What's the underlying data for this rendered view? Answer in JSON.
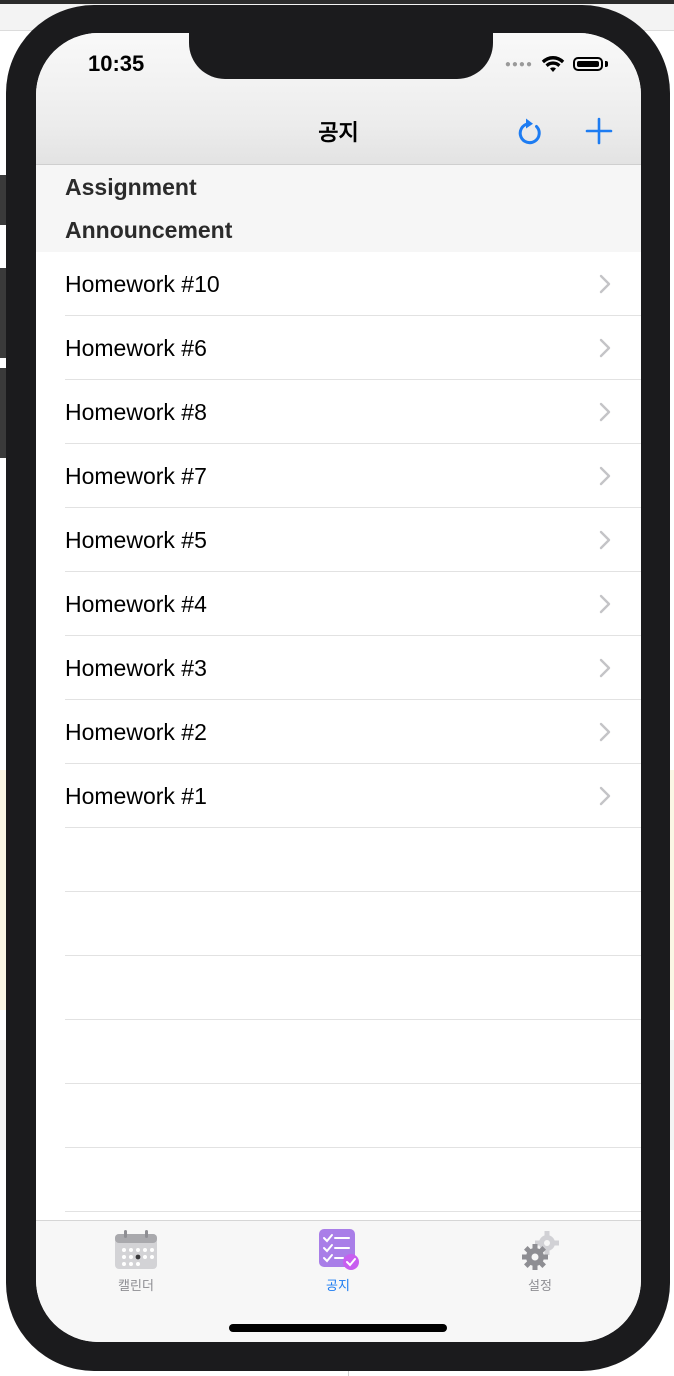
{
  "status_bar": {
    "time": "10:35"
  },
  "nav_bar": {
    "title": "공지",
    "actions": [
      "refresh-icon",
      "add-icon"
    ],
    "accent_color": "#1d7cf2"
  },
  "sections": [
    {
      "title": "Assignment"
    },
    {
      "title": "Announcement"
    }
  ],
  "announcements": [
    {
      "title": "Homework #10"
    },
    {
      "title": "Homework #6"
    },
    {
      "title": "Homework #8"
    },
    {
      "title": "Homework #7"
    },
    {
      "title": "Homework #5"
    },
    {
      "title": "Homework #4"
    },
    {
      "title": "Homework #3"
    },
    {
      "title": "Homework #2"
    },
    {
      "title": "Homework #1"
    }
  ],
  "tab_bar": {
    "tabs": [
      {
        "label": "캘린더",
        "icon": "calendar-icon",
        "active": false
      },
      {
        "label": "공지",
        "icon": "checklist-icon",
        "active": true
      },
      {
        "label": "설정",
        "icon": "gear-icon",
        "active": false
      }
    ],
    "active_color": "#1d7cf2",
    "inactive_color": "#8e8e93"
  }
}
